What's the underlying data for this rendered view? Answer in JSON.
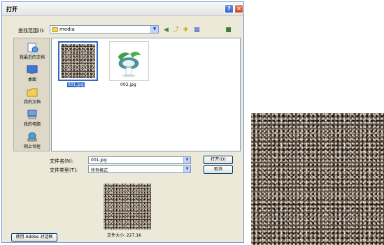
{
  "dialog": {
    "title": "打开",
    "help_label": "?",
    "close_label": "✕"
  },
  "lookin": {
    "label": "查找范围(I):",
    "value": "media"
  },
  "places": [
    {
      "label": "我最近的文档",
      "icon": "recent-documents-icon"
    },
    {
      "label": "桌面",
      "icon": "desktop-icon"
    },
    {
      "label": "我的文档",
      "icon": "my-documents-icon"
    },
    {
      "label": "我的电脑",
      "icon": "my-computer-icon"
    },
    {
      "label": "网上邻居",
      "icon": "network-places-icon"
    }
  ],
  "files": [
    {
      "name": "001.jpg",
      "selected": true
    },
    {
      "name": "002.jpg",
      "selected": false
    }
  ],
  "filename": {
    "label": "文件名(N):",
    "value": "001.jpg"
  },
  "filetype": {
    "label": "文件类型(T):",
    "value": "所有格式"
  },
  "buttons": {
    "open": "打开(O)",
    "cancel": "取消",
    "adobe": "使用 Adobe 对话框"
  },
  "preview": {
    "size_text": "文件大小: 227.1K"
  }
}
